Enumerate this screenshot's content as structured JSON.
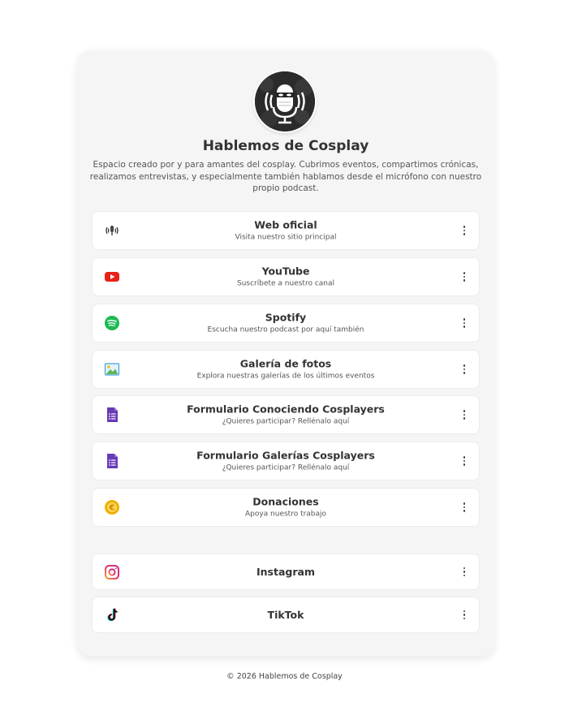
{
  "profile": {
    "title": "Hablemos de Cosplay",
    "description": "Espacio creado por y para amantes del cosplay. Cubrimos eventos, compartimos crónicas, realizamos entrevistas, y especialmente también hablamos desde el micrófono con nuestro propio podcast."
  },
  "links": [
    {
      "label": "Web oficial",
      "subtitle": "Visita nuestro sitio principal",
      "icon": "podcast-icon"
    },
    {
      "label": "YouTube",
      "subtitle": "Suscríbete a nuestro canal",
      "icon": "youtube-icon"
    },
    {
      "label": "Spotify",
      "subtitle": "Escucha nuestro podcast por aquí también",
      "icon": "spotify-icon"
    },
    {
      "label": "Galería de fotos",
      "subtitle": "Explora nuestras galerías de los últimos eventos",
      "icon": "gallery-icon"
    },
    {
      "label": "Formulario Conociendo Cosplayers",
      "subtitle": "¿Quieres participar? Rellénalo aquí",
      "icon": "form-icon"
    },
    {
      "label": "Formulario Galerías Cosplayers",
      "subtitle": "¿Quieres participar? Rellénalo aquí",
      "icon": "form-icon"
    },
    {
      "label": "Donaciones",
      "subtitle": "Apoya nuestro trabajo",
      "icon": "coin-icon"
    }
  ],
  "socials": [
    {
      "label": "Instagram",
      "icon": "instagram-icon"
    },
    {
      "label": "TikTok",
      "icon": "tiktok-icon"
    }
  ],
  "footer": {
    "text": "© 2026 Hablemos de Cosplay"
  },
  "colors": {
    "card_bg": "#f5f5f5",
    "youtube": "#e62117",
    "spotify": "#1db954",
    "form": "#673ab7",
    "coin": "#f5b400"
  }
}
